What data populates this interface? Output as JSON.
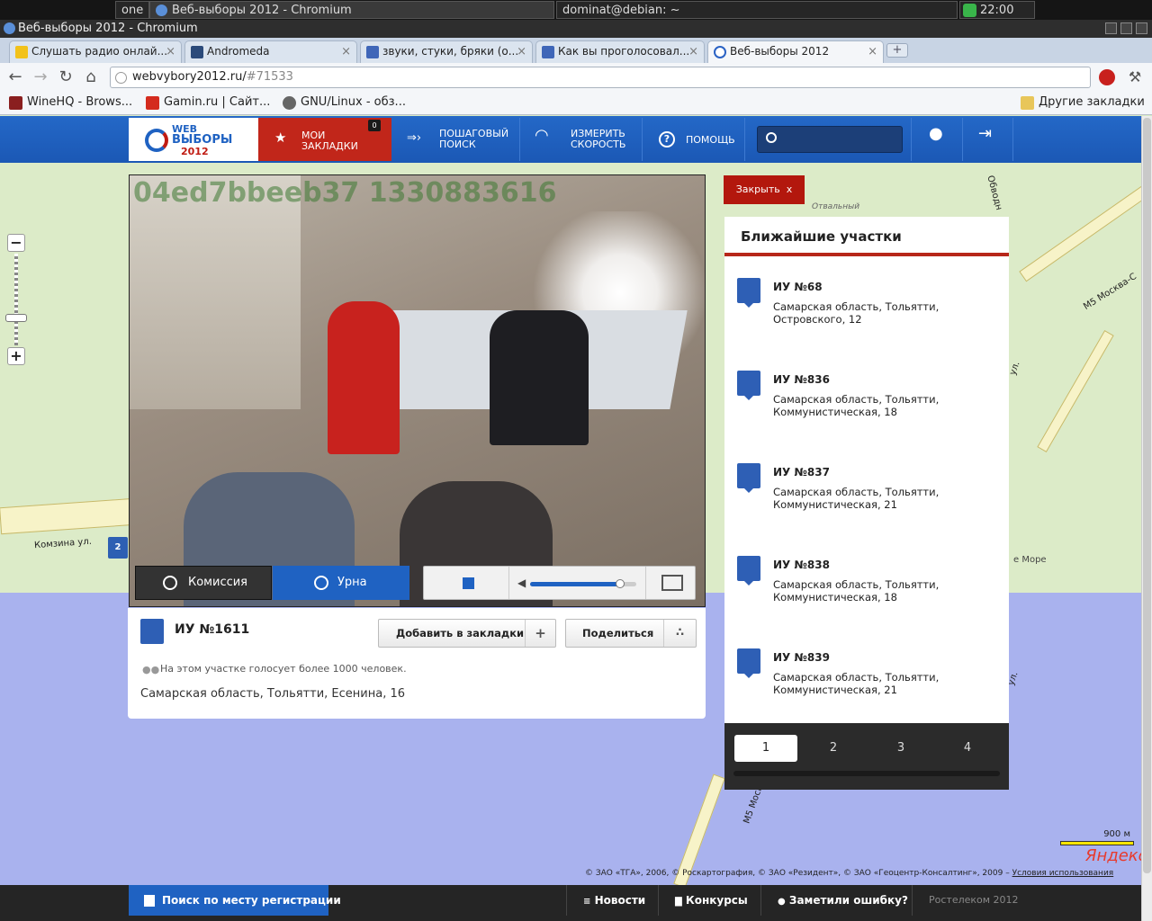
{
  "taskbar": {
    "workspace": "one",
    "window_task": "Веб-выборы 2012 - Chromium",
    "terminal_task": "dominat@debian: ~",
    "clock": "22:00"
  },
  "window": {
    "title": "Веб-выборы 2012 - Chromium"
  },
  "tabs": [
    {
      "label": "Слушать радио онлай...",
      "color": "#f2c21b"
    },
    {
      "label": "Andromeda",
      "color": "#2b4a7a"
    },
    {
      "label": "звуки, стуки, бряки (о...",
      "color": "#3f66b8"
    },
    {
      "label": "Как вы проголосовал...",
      "color": "#3f66b8"
    },
    {
      "label": "Веб-выборы 2012",
      "color": "#2a62c4"
    }
  ],
  "tab_close": "×",
  "newtab": "+",
  "address": {
    "host": "webvybory2012.ru/",
    "hash": "#71533"
  },
  "bookmarks": [
    {
      "label": "WineHQ - Brows...",
      "color": "#8a1f1f"
    },
    {
      "label": "Gamin.ru | Сайт...",
      "color": "#d42b1e"
    },
    {
      "label": "GNU/Linux - обз...",
      "color": "#666666"
    }
  ],
  "other_bookmarks": "Другие закладки",
  "site": {
    "logo_web": "WEB",
    "logo_vybory": "ВЫБОРЫ",
    "logo_year": "2012",
    "nav": {
      "bookmarks": "мои закладки",
      "bookmarks_count": "0",
      "search": "пошаговый поиск",
      "speed": "измерить скорость",
      "help": "помощь"
    },
    "search_placeholder": ""
  },
  "map_labels": {
    "komzina": "Комзина ул.",
    "more": "е Море",
    "m5": "М5 Москва-С",
    "m5b": "М5 Моск",
    "otvalny": "Отвальный",
    "obvodnaya": "Обводн",
    "ul": "ул.",
    "marker": "2",
    "scale": "900 м",
    "yandex": "Яндекс",
    "copyright": "© ЗАО «ТГА», 2006, © Роскартография, © ЗАО «Резидент», © ЗАО «Геоцентр-Консалтинг», 2009 –",
    "terms": "Условия использования"
  },
  "video": {
    "overlay_id": "04ed7bbeeb37 1330883616",
    "tab_commission": "Комиссия",
    "tab_urn": "Урна",
    "volume": 0.85
  },
  "station": {
    "title": "ИУ №1611",
    "bookmark_btn": "Добавить в закладки",
    "share_btn": "Поделиться",
    "note": "На этом участке голосует более 1000 человек.",
    "address": "Самарская область, Тольятти, Есенина, 16"
  },
  "close_btn": "Закрыть",
  "close_x": "x",
  "nearby": {
    "title": "Ближайшие участки",
    "items": [
      {
        "no": "ИУ №68",
        "addr1": "Самарская область, Тольятти,",
        "addr2": "Островского, 12"
      },
      {
        "no": "ИУ №836",
        "addr1": "Самарская область, Тольятти,",
        "addr2": "Коммунистическая, 18"
      },
      {
        "no": "ИУ №837",
        "addr1": "Самарская область, Тольятти,",
        "addr2": "Коммунистическая, 21"
      },
      {
        "no": "ИУ №838",
        "addr1": "Самарская область, Тольятти,",
        "addr2": "Коммунистическая, 18"
      },
      {
        "no": "ИУ №839",
        "addr1": "Самарская область, Тольятти,",
        "addr2": "Коммунистическая, 21"
      }
    ],
    "pages": [
      "1",
      "2",
      "3",
      "4"
    ]
  },
  "footer": {
    "registration": "Поиск по месту регистрации",
    "news": "Новости",
    "contests": "Конкурсы",
    "error": "Заметили ошибку?",
    "copyright": "Ростелеком 2012"
  },
  "colors": {
    "brand_blue": "#1f62c2",
    "brand_red": "#b3170d",
    "footer": "#252525",
    "lake": "#a9b2ee"
  }
}
